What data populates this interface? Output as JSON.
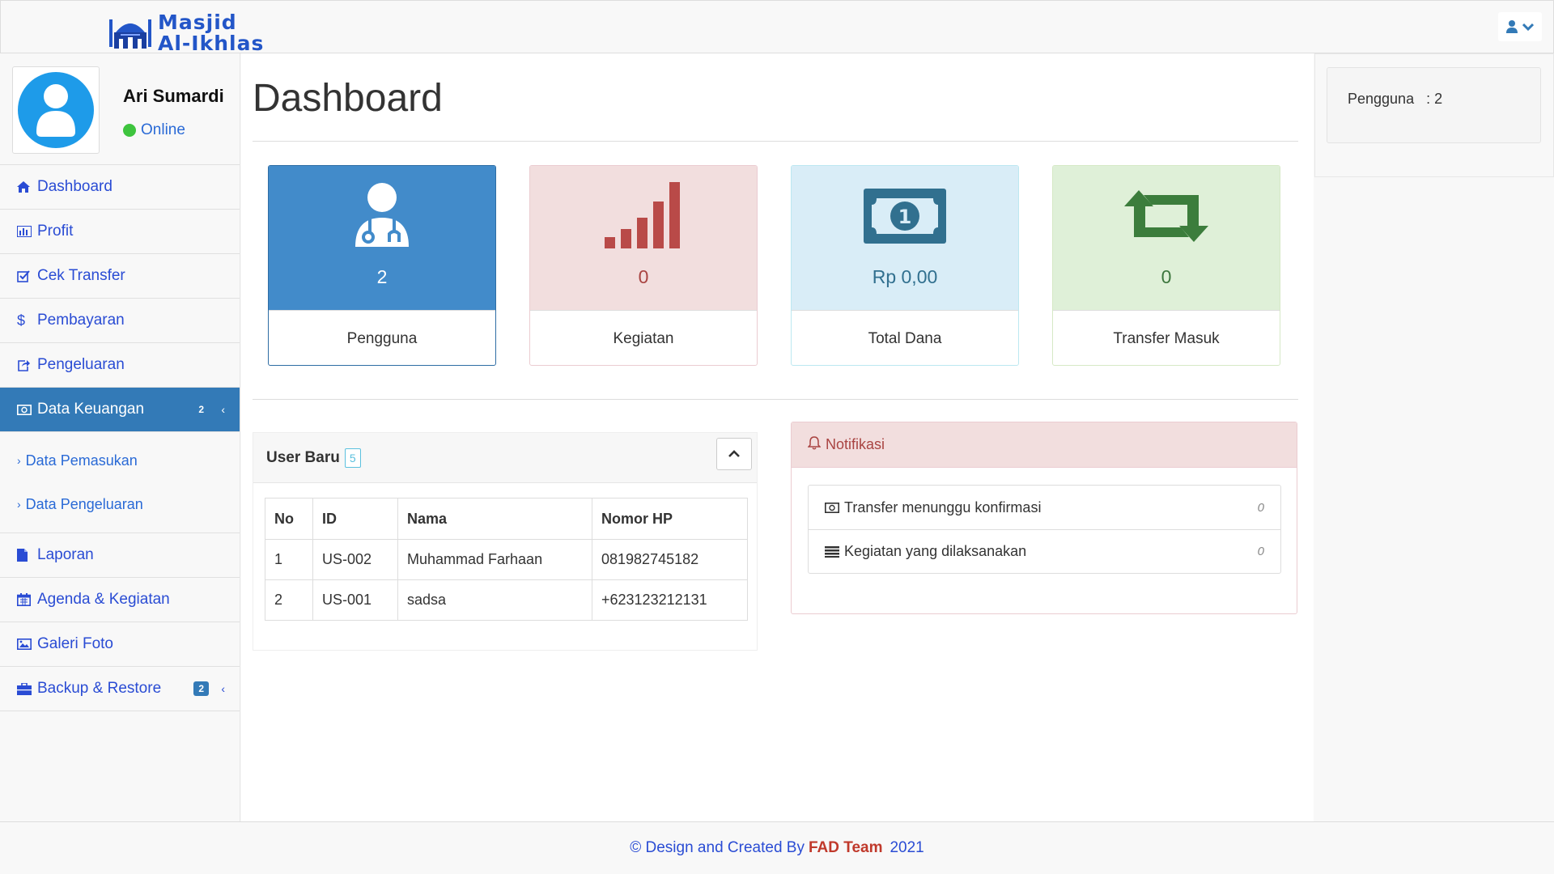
{
  "brand": {
    "line1": "Masjid",
    "line2": "Al-Ikhlas"
  },
  "header": {
    "user_icon": "user-icon",
    "caret_icon": "chevron-down-icon"
  },
  "profile": {
    "name": "Ari Sumardi",
    "status": "Online"
  },
  "sidebar": {
    "items": [
      {
        "label": "Dashboard",
        "icon": "home-icon"
      },
      {
        "label": "Profit",
        "icon": "bar-chart-icon"
      },
      {
        "label": "Cek Transfer",
        "icon": "check-square-icon"
      },
      {
        "label": "Pembayaran",
        "icon": "dollar-icon"
      },
      {
        "label": "Pengeluaran",
        "icon": "share-icon"
      },
      {
        "label": "Data Keuangan",
        "icon": "money-icon",
        "badge": "2"
      },
      {
        "label": "Laporan",
        "icon": "file-icon"
      },
      {
        "label": "Agenda & Kegiatan",
        "icon": "calendar-icon"
      },
      {
        "label": "Galeri Foto",
        "icon": "image-icon"
      },
      {
        "label": "Backup & Restore",
        "icon": "briefcase-icon",
        "badge": "2"
      }
    ],
    "submenu": [
      {
        "label": "Data Pemasukan"
      },
      {
        "label": "Data Pengeluaran"
      }
    ]
  },
  "main": {
    "title": "Dashboard"
  },
  "stats": [
    {
      "value": "2",
      "label": "Pengguna",
      "icon": "user-doctor-icon",
      "color": "#428bca"
    },
    {
      "value": "0",
      "label": "Kegiatan",
      "icon": "signal-icon",
      "color": "#f2dede"
    },
    {
      "value": "Rp 0,00",
      "label": "Total Dana",
      "icon": "money-bill-icon",
      "color": "#d9edf7"
    },
    {
      "value": "0",
      "label": "Transfer Masuk",
      "icon": "retweet-icon",
      "color": "#dff0d8"
    }
  ],
  "user_panel": {
    "title": "User Baru",
    "badge": "5",
    "columns": [
      "No",
      "ID",
      "Nama",
      "Nomor HP"
    ],
    "rows": [
      [
        "1",
        "US-002",
        "Muhammad Farhaan",
        "081982745182"
      ],
      [
        "2",
        "US-001",
        "sadsa",
        "+623123212131"
      ]
    ]
  },
  "notif_panel": {
    "title": "Notifikasi",
    "items": [
      {
        "label": "Transfer menunggu konfirmasi",
        "count": "0",
        "icon": "money-icon"
      },
      {
        "label": "Kegiatan yang dilaksanakan",
        "count": "0",
        "icon": "list-icon"
      }
    ]
  },
  "right_panel": {
    "text": "Pengguna   : 2"
  },
  "footer": {
    "prefix": "© Design and Created By",
    "team": "FAD Team",
    "year": "2021"
  }
}
